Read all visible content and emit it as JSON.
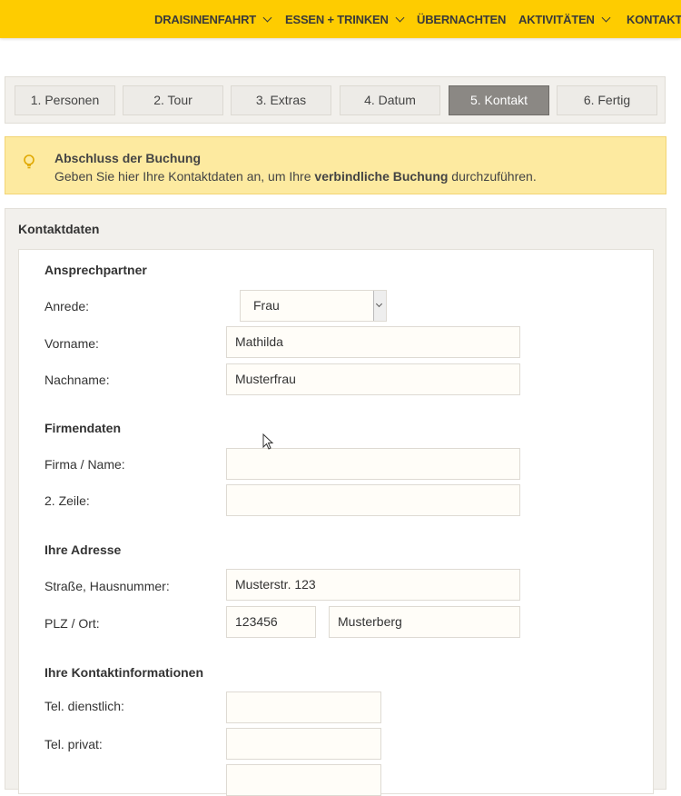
{
  "nav": {
    "items": [
      {
        "label": "DRAISINENFAHRT",
        "dropdown": true
      },
      {
        "label": "ESSEN + TRINKEN",
        "dropdown": true
      },
      {
        "label": "ÜBERNACHTEN",
        "dropdown": false
      },
      {
        "label": "AKTIVITÄTEN",
        "dropdown": true
      },
      {
        "label": "KONTAKT",
        "dropdown": false
      }
    ],
    "background": "#fecc00"
  },
  "steps": [
    {
      "label": "1.  Personen"
    },
    {
      "label": "2.  Tour"
    },
    {
      "label": "3.  Extras"
    },
    {
      "label": "4.  Datum"
    },
    {
      "label": "5.  Kontakt",
      "active": true
    },
    {
      "label": "6.  Fertig"
    }
  ],
  "alert": {
    "icon": "lightbulb-icon",
    "title": "Abschluss der Buchung",
    "text_before": "Geben Sie hier Ihre Kontaktdaten an, um Ihre ",
    "text_bold": "verbindliche Buchung",
    "text_after": " durchzuführen."
  },
  "panel": {
    "title": "Kontaktdaten"
  },
  "form": {
    "contact": {
      "heading": "Ansprechpartner",
      "anrede_label": "Anrede:",
      "anrede_value": "Frau",
      "vorname_label": "Vorname:",
      "vorname_value": "Mathilda",
      "nachname_label": "Nachname:",
      "nachname_value": "Musterfrau"
    },
    "company": {
      "heading": "Firmendaten",
      "firma_label": "Firma / Name:",
      "firma_value": "",
      "zeile2_label": "2. Zeile:",
      "zeile2_value": ""
    },
    "address": {
      "heading": "Ihre Adresse",
      "strasse_label": "Straße, Hausnummer:",
      "strasse_value": "Musterstr. 123",
      "plzort_label": "PLZ / Ort:",
      "plz_value": "123456",
      "ort_value": "Musterberg"
    },
    "contactinfo": {
      "heading": "Ihre Kontaktinformationen",
      "tel_dienst_label": "Tel. dienstlich:",
      "tel_dienst_value": "",
      "tel_privat_label": "Tel. privat:",
      "tel_privat_value": ""
    }
  }
}
